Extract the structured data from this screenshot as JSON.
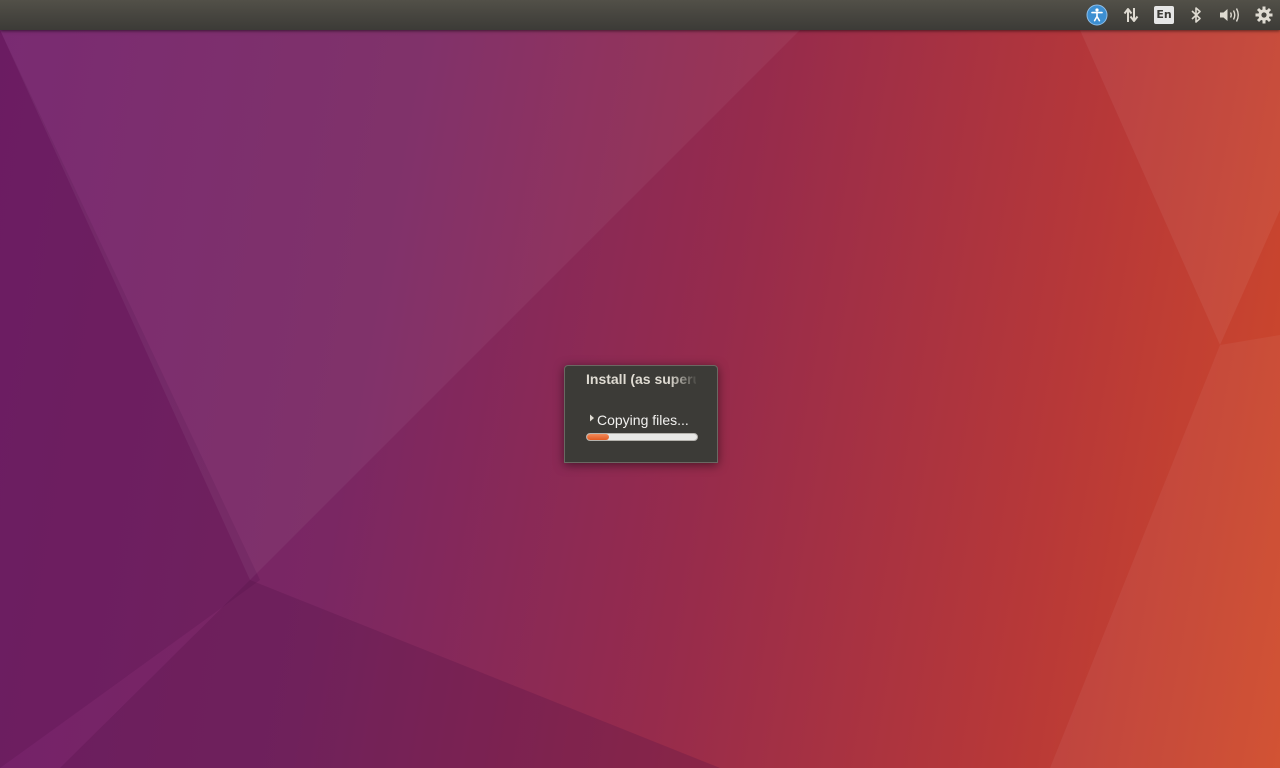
{
  "dialog": {
    "title": "Install (as superuser)",
    "status": "Copying files...",
    "progress": 0.2
  },
  "panel": {
    "indicators": [
      {
        "icon": "accessibility-icon"
      },
      {
        "icon": "network-icon"
      },
      {
        "icon": "keyboard-layout-icon",
        "label": "En"
      },
      {
        "icon": "bluetooth-icon"
      },
      {
        "icon": "sound-icon"
      },
      {
        "icon": "session-gear-icon"
      }
    ]
  },
  "colors": {
    "panel": "#3c3b37",
    "accent": "#e95420",
    "accessibility": "#3d8fd1",
    "dialog_bg": "#3c3b37"
  }
}
